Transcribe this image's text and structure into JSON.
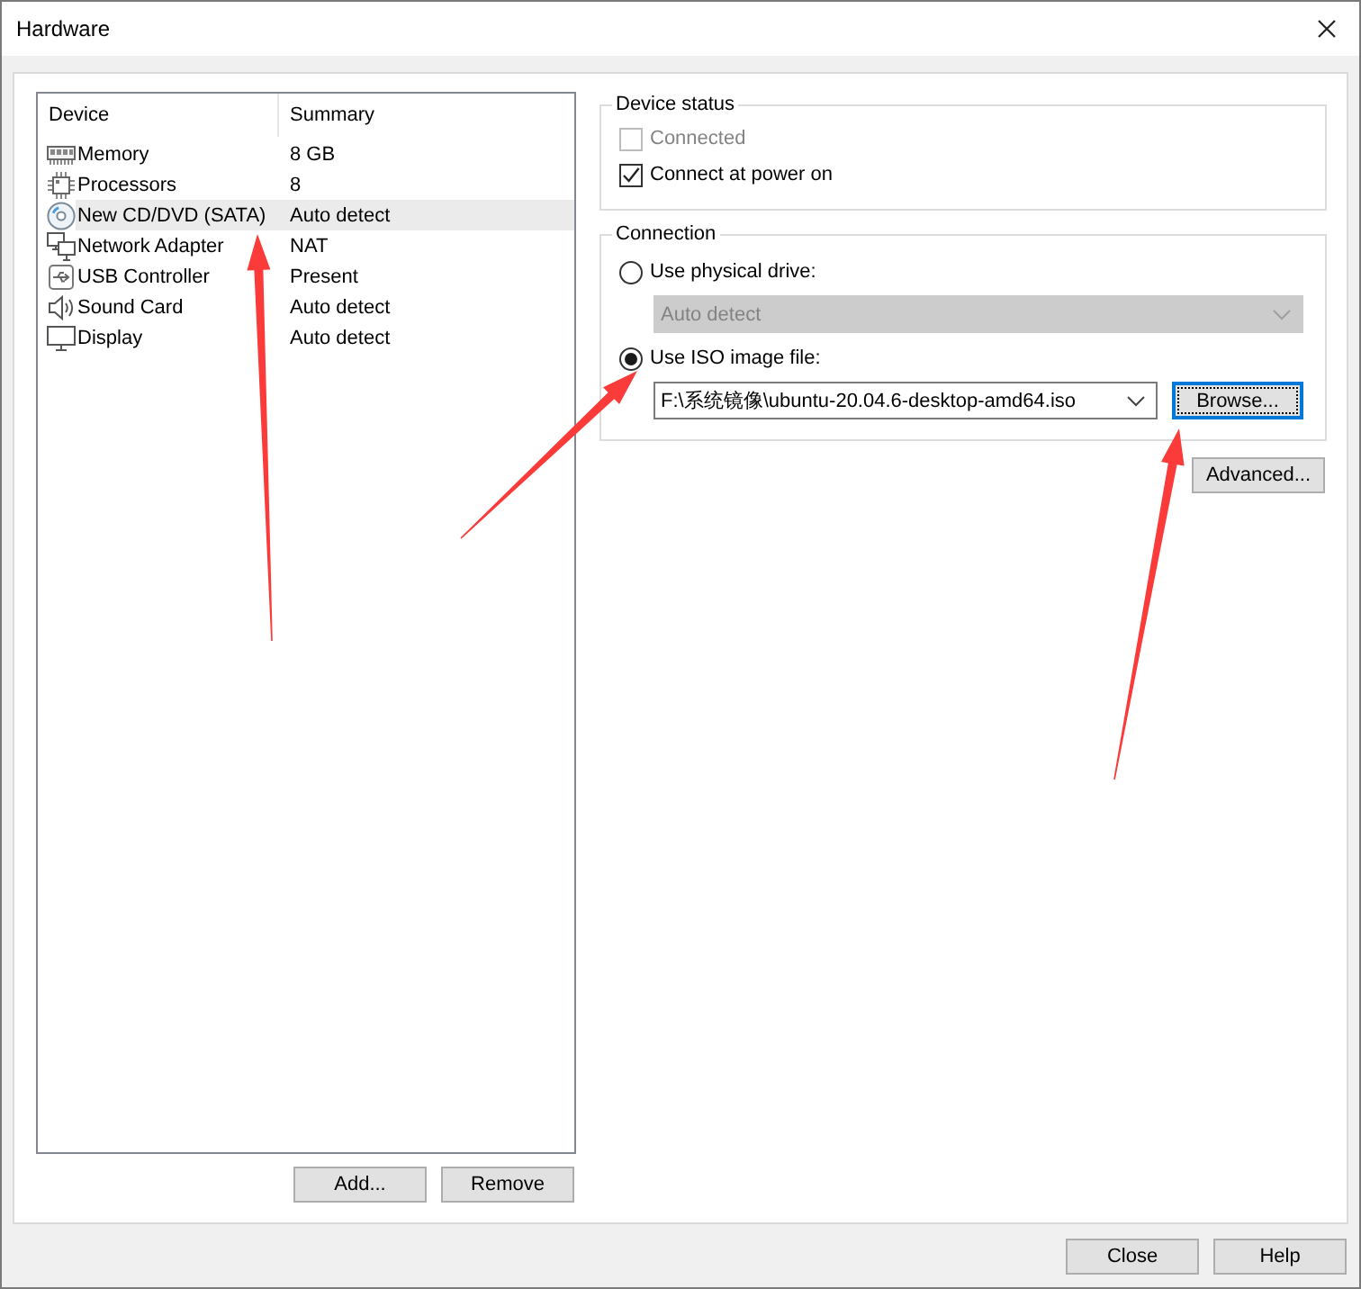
{
  "window": {
    "title": "Hardware"
  },
  "device_list": {
    "columns": [
      "Device",
      "Summary"
    ],
    "rows": [
      {
        "kind": "memory",
        "device": "Memory",
        "summary": "8 GB",
        "selected": false
      },
      {
        "kind": "processor",
        "device": "Processors",
        "summary": "8",
        "selected": false
      },
      {
        "kind": "cdrom",
        "device": "New CD/DVD (SATA)",
        "summary": "Auto detect",
        "selected": true
      },
      {
        "kind": "network",
        "device": "Network Adapter",
        "summary": "NAT",
        "selected": false
      },
      {
        "kind": "usb",
        "device": "USB Controller",
        "summary": "Present",
        "selected": false
      },
      {
        "kind": "sound",
        "device": "Sound Card",
        "summary": "Auto detect",
        "selected": false
      },
      {
        "kind": "display",
        "device": "Display",
        "summary": "Auto detect",
        "selected": false
      }
    ]
  },
  "list_buttons": [
    "Add...",
    "Remove"
  ],
  "device_status": {
    "title": "Device status",
    "checkboxes": [
      {
        "label": "Connected",
        "checked": false,
        "disabled": true
      },
      {
        "label": "Connect at power on",
        "checked": true,
        "disabled": false
      }
    ]
  },
  "connection": {
    "title": "Connection",
    "options": [
      {
        "label": "Use physical drive:",
        "selected": false,
        "field": {
          "value": "Auto detect",
          "disabled": true
        }
      },
      {
        "label": "Use ISO image file:",
        "selected": true,
        "field": {
          "value": "F:\\系统镜像\\ubuntu-20.04.6-desktop-amd64.iso",
          "disabled": false
        },
        "button": {
          "label": "Browse...",
          "focused": true
        }
      }
    ]
  },
  "advanced_button": "Advanced...",
  "dialog_buttons": [
    "Close",
    "Help"
  ]
}
